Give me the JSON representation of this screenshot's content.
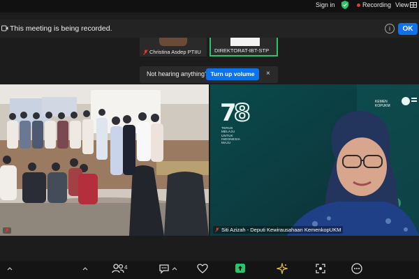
{
  "header": {
    "sign_in": "Sign in",
    "recording": "Recording",
    "view": "View",
    "shield_color": "#2ec36a",
    "record_color": "#e53935"
  },
  "banner": {
    "text": "This meeting is being recorded.",
    "info_icon": "i",
    "ok": "OK"
  },
  "thumbnails": [
    {
      "name": "Christina Asdep PTIIU",
      "muted": true
    },
    {
      "name": "DIREKTORAT-IBT-STP",
      "muted": false,
      "active_speaker": true
    }
  ],
  "toast": {
    "message": "Not hearing anything?",
    "button": "Turn up volume",
    "close": "×"
  },
  "tiles": {
    "right_name": "Siti Azizah - Deputi Kewirausahaan KemenkopUKM",
    "tagline": [
      "TERUS",
      "MELAJU",
      "UNTUK",
      "INDONESIA",
      "MAJU"
    ],
    "sponsor": [
      "KEMEN",
      "KOPUKM"
    ]
  },
  "toolbar": {
    "participants_count": "4",
    "accent": "#2ec36a"
  }
}
